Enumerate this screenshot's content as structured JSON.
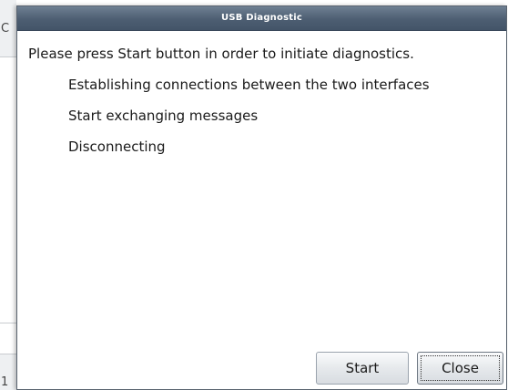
{
  "background_window": {
    "letter_top": "C",
    "letter_bottom": "1"
  },
  "dialog": {
    "title": "USB Diagnostic",
    "instruction": "Please press Start button in order to initiate diagnostics.",
    "steps": [
      "Establishing connections between the two interfaces",
      "Start exchanging messages",
      "Disconnecting"
    ],
    "buttons": {
      "start_label": "Start",
      "close_label": "Close"
    }
  },
  "colors": {
    "titlebar": "#4d5e72",
    "title_text": "#ffffff",
    "dialog_background": "#ffffff"
  }
}
